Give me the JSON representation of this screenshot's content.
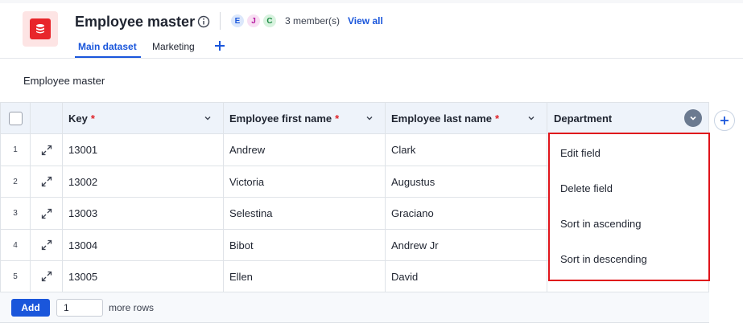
{
  "header": {
    "title": "Employee master",
    "members": {
      "avatars": [
        "E",
        "J",
        "C"
      ],
      "count_label": "3 member(s)",
      "view_all": "View all"
    },
    "tabs": [
      {
        "label": "Main dataset",
        "active": true
      },
      {
        "label": "Marketing",
        "active": false
      }
    ]
  },
  "section_title": "Employee master",
  "table": {
    "columns": [
      {
        "label": "Key",
        "required": "*"
      },
      {
        "label": "Employee first name",
        "required": "*"
      },
      {
        "label": "Employee last name",
        "required": "*"
      },
      {
        "label": "Department",
        "required": ""
      }
    ],
    "rows": [
      {
        "no": "1",
        "key": "13001",
        "first": "Andrew",
        "last": "Clark"
      },
      {
        "no": "2",
        "key": "13002",
        "first": "Victoria",
        "last": "Augustus"
      },
      {
        "no": "3",
        "key": "13003",
        "first": "Selestina",
        "last": "Graciano"
      },
      {
        "no": "4",
        "key": "13004",
        "first": "Bibot",
        "last": "Andrew Jr"
      },
      {
        "no": "5",
        "key": "13005",
        "first": "Ellen",
        "last": "David"
      }
    ]
  },
  "column_menu": {
    "items": [
      "Edit field",
      "Delete field",
      "Sort in ascending",
      "Sort in descending"
    ]
  },
  "footer": {
    "add_label": "Add",
    "rows_value": "1",
    "more_rows": "more rows"
  },
  "colors": {
    "accent": "#1a56db",
    "required": "#e0242a",
    "highlight": "#e0141b",
    "brand": "#e8262b"
  },
  "icons": [
    "database-icon",
    "info-icon",
    "chevron-down-icon",
    "expand-icon",
    "plus-icon"
  ]
}
